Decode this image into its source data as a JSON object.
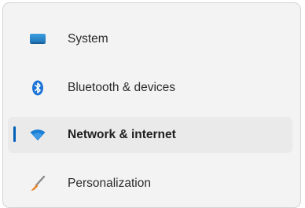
{
  "sidebar": {
    "accent_color": "#005fb8",
    "selected_item": "Network & internet",
    "items": [
      {
        "label": "System",
        "icon": "monitor-icon"
      },
      {
        "label": "Bluetooth & devices",
        "icon": "bluetooth-icon"
      },
      {
        "label": "Network & internet",
        "icon": "wifi-icon",
        "selected": true
      },
      {
        "label": "Personalization",
        "icon": "paintbrush-icon"
      }
    ]
  }
}
